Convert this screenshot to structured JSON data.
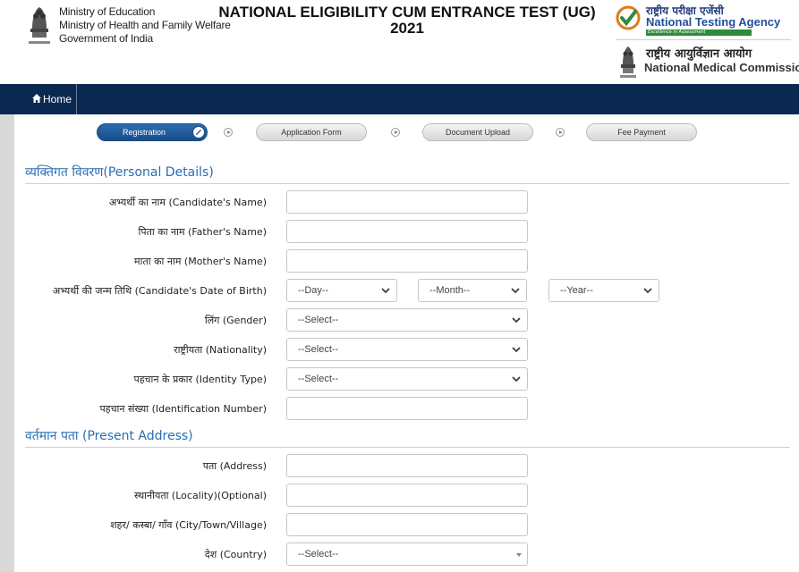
{
  "header": {
    "ministry_lines": [
      "Ministry of Education",
      "Ministry of Health and Family Welfare",
      "Government of India"
    ],
    "title_line1": "NATIONAL ELIGIBILITY CUM ENTRANCE TEST (UG)",
    "title_line2": "2021",
    "nta_hindi": "राष्ट्रीय परीक्षा एजेंसी",
    "nta_name": "National Testing Agency",
    "nta_tagline": "Excellence in Assessment",
    "nmc_hindi": "राष्ट्रीय आयुर्विज्ञान आयोग",
    "nmc_name": "National Medical Commission"
  },
  "nav": {
    "home_label": "Home"
  },
  "steps": [
    "Registration",
    "Application Form",
    "Document Upload",
    "Fee Payment"
  ],
  "personal": {
    "title": "व्यक्तिगत विवरण(Personal Details)",
    "name_label": "अभ्यर्थी का नाम (Candidate's Name)",
    "father_label": "पिता का नाम (Father's Name)",
    "mother_label": "माता का नाम (Mother's Name)",
    "dob_label": "अभ्यर्थी की जन्म तिथि (Candidate's Date of Birth)",
    "dob_day": "--Day--",
    "dob_month": "--Month--",
    "dob_year": "--Year--",
    "gender_label": "लिंग (Gender)",
    "gender_value": "--Select--",
    "nationality_label": "राष्ट्रीयता (Nationality)",
    "nationality_value": "--Select--",
    "idtype_label": "पहचान के प्रकार (Identity Type)",
    "idtype_value": "--Select--",
    "idnum_label": "पहचान संख्या (Identification Number)"
  },
  "address": {
    "title": "वर्तमान पता (Present Address)",
    "address_label": "पता (Address)",
    "locality_label": "स्थानीयता (Locality)(Optional)",
    "city_label": "शहर/ कस्बा/ गाँव (City/Town/Village)",
    "country_label": "देश (Country)",
    "country_value": "--Select--"
  },
  "colors": {
    "nav_bg": "#0b2850",
    "accent": "#2a6cb5",
    "step_active": "#1a4c88"
  },
  "icons": {
    "home": "home-icon",
    "check": "check-icon",
    "arrow": "arrow-right-icon",
    "dropdown": "chevron-down-icon"
  }
}
